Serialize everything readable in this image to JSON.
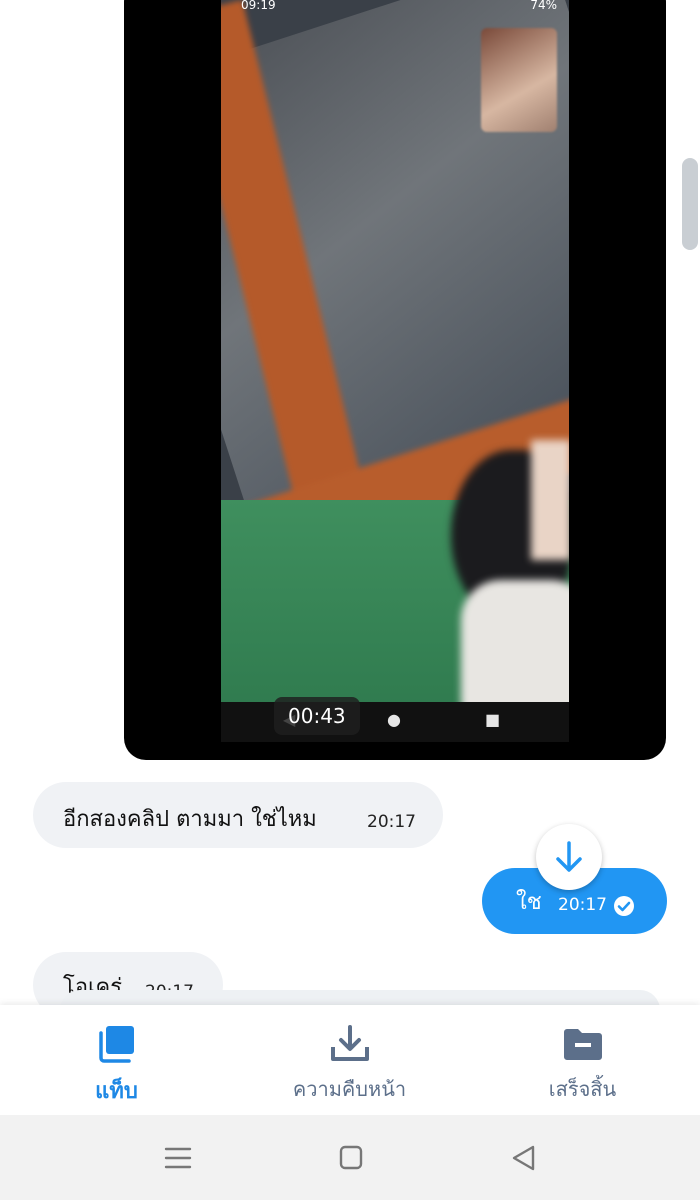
{
  "video": {
    "status_time": "09:19",
    "status_battery": "74%",
    "duration": "00:43"
  },
  "messages": [
    {
      "direction": "in",
      "text": "อีกสองคลิป ตามมา ใช่ไหม",
      "time": "20:17"
    },
    {
      "direction": "out",
      "text": "ใช",
      "time": "20:17"
    },
    {
      "direction": "in",
      "text": "โอเคร่",
      "time": "20:17"
    }
  ],
  "tabbar": {
    "tabs": [
      {
        "label": "แท็บ",
        "icon": "tabs-icon",
        "active": true
      },
      {
        "label": "ความคืบหน้า",
        "icon": "download-icon",
        "active": false
      },
      {
        "label": "เสร็จสิ้น",
        "icon": "folder-icon",
        "active": false
      }
    ]
  },
  "colors": {
    "accent": "#2196f3",
    "active_tab": "#1e88e5",
    "inactive_tab": "#5c6f8a",
    "incoming_bubble": "#f0f2f5"
  },
  "system_nav": {
    "icons": [
      "recent-apps-icon",
      "home-icon",
      "back-icon"
    ]
  }
}
